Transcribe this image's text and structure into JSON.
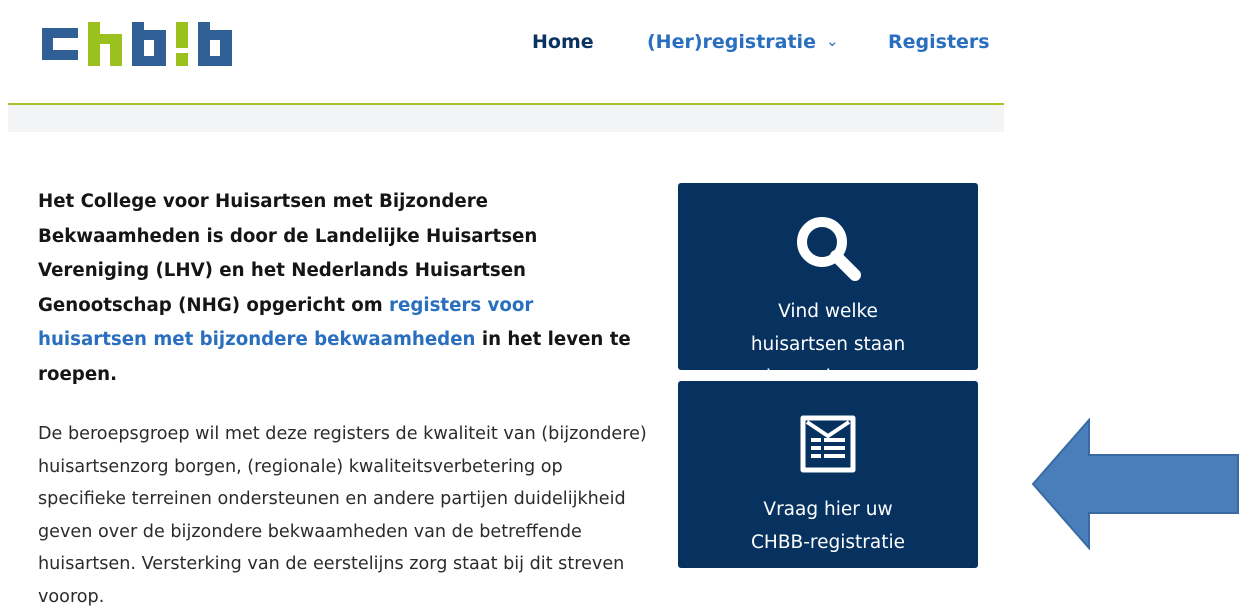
{
  "brand": {
    "logo_text": "chb!b",
    "colors": {
      "blue": "#2f5f94",
      "green": "#9bc11f",
      "navy": "#07325f",
      "link": "#2a6fbf",
      "rule": "#a9c12b"
    }
  },
  "nav": {
    "home": "Home",
    "registratie": "(Her)registratie",
    "registers": "Registers"
  },
  "intro": {
    "part1": "Het College voor Huisartsen met Bijzondere Bekwaamheden is door de Landelijke Huisartsen Vereniging (LHV) en het Nederlands Huisartsen Genootschap (NHG) opgericht om ",
    "link": "registers voor huisartsen met bijzondere bekwaamheden",
    "part2": " in het leven te roepen."
  },
  "body": {
    "paragraph": "De beroepsgroep wil met deze registers de kwaliteit van (bijzondere) huisartsenzorg borgen, (regionale) kwaliteitsverbetering op specifieke terreinen ondersteunen en andere partijen duidelijkheid geven over de bijzondere bekwaamheden van de betreffende huisartsen. Versterking van de eerstelijns zorg staat bij dit streven voorop."
  },
  "cards": {
    "search": {
      "label": "Vind welke huisartsen staan ingeschreven",
      "icon": "search-icon"
    },
    "register": {
      "label": "Vraag hier uw CHBB-registratie aan",
      "icon": "form-icon"
    }
  },
  "annotation": {
    "icon": "left-arrow-icon",
    "color": "#4a7ebb"
  }
}
